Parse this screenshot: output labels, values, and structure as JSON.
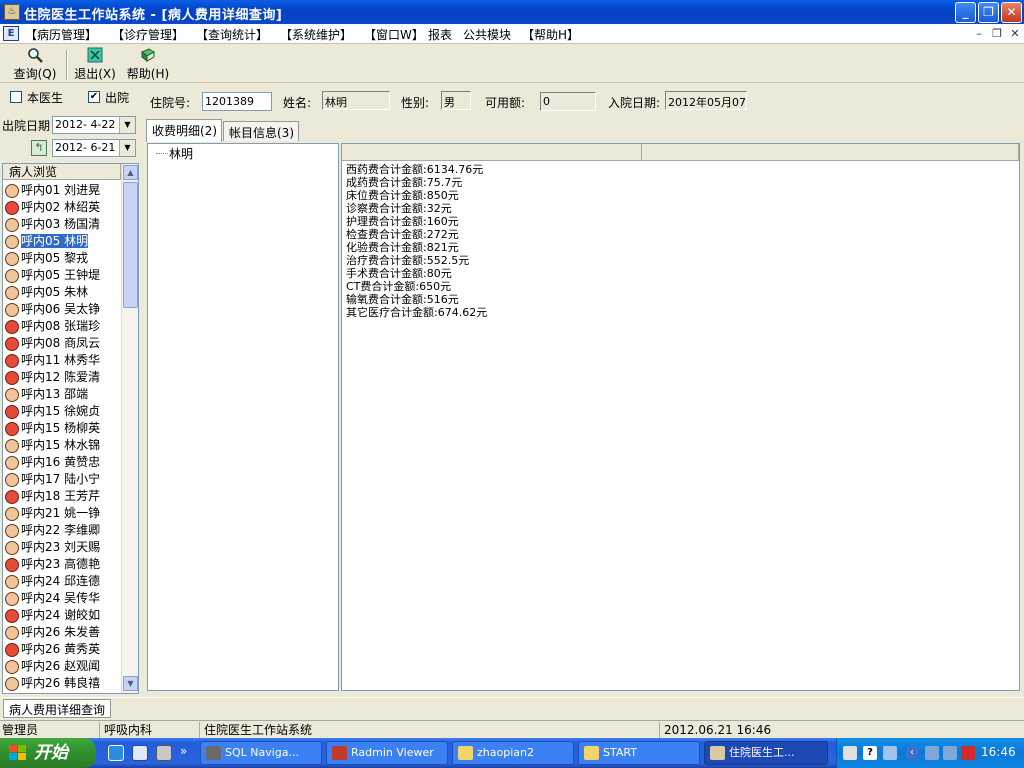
{
  "window": {
    "title": "住院医生工作站系统 - [病人费用详细查询]",
    "controls": {
      "minimize": "_",
      "restore": "❐",
      "close": "✕"
    }
  },
  "menu": {
    "items": [
      "【病历管理】",
      "【诊疗管理】",
      "【查询统计】",
      "【系统维护】",
      "【窗口W】",
      "报表",
      "公共模块",
      "【帮助H】"
    ],
    "mdi_controls": [
      "–",
      "❐",
      "✕"
    ]
  },
  "toolbar": {
    "query": "查询(Q)",
    "exit": "退出(X)",
    "help": "帮助(H)"
  },
  "filters": {
    "this_doctor_label": "本医生",
    "this_doctor_checked": false,
    "discharged_label": "出院",
    "discharged_checked": true,
    "discharge_date_label": "出院日期",
    "date_from": "2012- 4-22",
    "date_to": "2012- 6-21"
  },
  "patient_info": {
    "inpatient_no_label": "住院号:",
    "inpatient_no": "1201389",
    "name_label": "姓名:",
    "name": "林明",
    "gender_label": "性别:",
    "gender": "男",
    "available_label": "可用额:",
    "available": "0",
    "admission_date_label": "入院日期:",
    "admission_date": "2012年05月07日"
  },
  "patient_list": {
    "header": "病人浏览",
    "selected_index": 3,
    "rows": [
      {
        "text": "呼内01 刘进晃",
        "icon": "male"
      },
      {
        "text": "呼内02 林绍英",
        "icon": "female"
      },
      {
        "text": "呼内03 杨国清",
        "icon": "male"
      },
      {
        "text": "呼内05 林明",
        "icon": "male"
      },
      {
        "text": "呼内05 黎戎",
        "icon": "male"
      },
      {
        "text": "呼内05 王钟堤",
        "icon": "male"
      },
      {
        "text": "呼内05 朱林",
        "icon": "male"
      },
      {
        "text": "呼内06 吴太铮",
        "icon": "male"
      },
      {
        "text": "呼内08 张瑞珍",
        "icon": "female"
      },
      {
        "text": "呼内08 商凤云",
        "icon": "female"
      },
      {
        "text": "呼内11 林秀华",
        "icon": "female"
      },
      {
        "text": "呼内12 陈爱清",
        "icon": "female"
      },
      {
        "text": "呼内13 邵端",
        "icon": "male"
      },
      {
        "text": "呼内15 徐婉贞",
        "icon": "female"
      },
      {
        "text": "呼内15 杨柳英",
        "icon": "female"
      },
      {
        "text": "呼内15 林水锦",
        "icon": "male"
      },
      {
        "text": "呼内16 黄赞忠",
        "icon": "male"
      },
      {
        "text": "呼内17 陆小宁",
        "icon": "male"
      },
      {
        "text": "呼内18 王芳芹",
        "icon": "female"
      },
      {
        "text": "呼内21 姚一铮",
        "icon": "male"
      },
      {
        "text": "呼内22 李维卿",
        "icon": "male"
      },
      {
        "text": "呼内23 刘天赐",
        "icon": "male"
      },
      {
        "text": "呼内23 高德艳",
        "icon": "female"
      },
      {
        "text": "呼内24 邱连德",
        "icon": "male"
      },
      {
        "text": "呼内24 吴传华",
        "icon": "male"
      },
      {
        "text": "呼内24 谢皎如",
        "icon": "female"
      },
      {
        "text": "呼内26 朱发善",
        "icon": "male"
      },
      {
        "text": "呼内26 黄秀英",
        "icon": "female"
      },
      {
        "text": "呼内26 赵观闻",
        "icon": "male"
      },
      {
        "text": "呼内26 韩良禧",
        "icon": "male"
      }
    ]
  },
  "tabs": [
    {
      "label": "收费明细(2)",
      "active": true
    },
    {
      "label": "帐目信息(3)",
      "active": false
    }
  ],
  "tree": {
    "root": "林明"
  },
  "fee_details": [
    "西药费合计金额:6134.76元",
    "成药费合计金额:75.7元",
    "床位费合计金额:850元",
    "诊察费合计金额:32元",
    "护理费合计金额:160元",
    "检查费合计金额:272元",
    "化验费合计金额:821元",
    "治疗费合计金额:552.5元",
    "手术费合计金额:80元",
    "CT费合计金额:650元",
    "输氧费合计金额:516元",
    "其它医疗合计金额:674.62元"
  ],
  "mdi_tab": "病人费用详细查询",
  "statusbar": {
    "user": "管理员",
    "department": "呼吸内科",
    "system": "住院医生工作站系统",
    "datetime": "2012.06.21 16:46"
  },
  "taskbar": {
    "start": "开始",
    "tasks": [
      {
        "label": "SQL Naviga...",
        "active": false
      },
      {
        "label": "Radmin Viewer",
        "active": false
      },
      {
        "label": "zhaopian2",
        "active": false
      },
      {
        "label": "START",
        "active": false
      },
      {
        "label": "住院医生工...",
        "active": true
      }
    ],
    "clock": "16:46"
  }
}
